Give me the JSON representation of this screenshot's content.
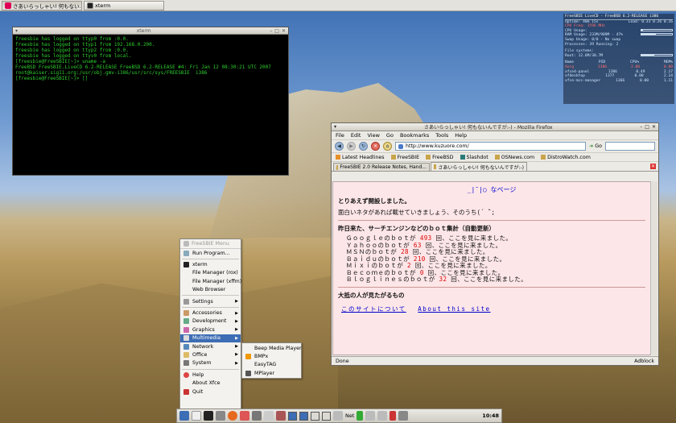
{
  "taskbar_top": [
    {
      "label": "さあいらっしゃい! 何もない...",
      "active": true
    },
    {
      "label": "xterm",
      "active": false
    }
  ],
  "conky": {
    "header": "FreeSBIE LiveCD - FreeBSD 6.2-RELEASE i386",
    "uptime": "Uptime: 40m 15s",
    "load": "Load: 0.33 0.26 0.26",
    "cpu_freq": "CPU Freq: 1596 MHz",
    "cpu_usage": "CPU Usage:",
    "ram_usage": "RAM Usage: 233M/989M - 47%",
    "swap_usage": "Swap Usage: 0/0 - No swap",
    "processes": "Processes: 39  Running: 2",
    "fs_label": "File systems:",
    "fs_root": "Root: 12.6M/30.7M",
    "cols": [
      "Name",
      "PID",
      "CPU%",
      "MEM%"
    ],
    "procs": [
      [
        "Xorg",
        "1386",
        "2.00",
        "0.00"
      ],
      [
        "xfce4-panel",
        "1386",
        "0.49",
        "2.17"
      ],
      [
        "xfdesktop",
        "1377",
        "0.00",
        "2.14"
      ],
      [
        "xfce-mcs-manager",
        "1366",
        "0.00",
        "1.11"
      ]
    ]
  },
  "xterm": {
    "title": "xterm",
    "lines": [
      "freesbie has logged on ttyp0 from :0.0.",
      "freesbie has logged on ttyp1 from 192.168.0.200.",
      "freesbie has logged on ttyp2 from :0.0.",
      "freesbie has logged on ttyv0 from local.",
      "[freesbie@FreeSBIE[~]> uname -a",
      "FreeBSD FreeSBIE.LiveCD 6.2-RELEASE FreeBSD 6.2-RELEASE #4: Fri Jan 12 08:30:21 UTC 2007     root@kaiser.sig11.org:/usr/obj.gmv-i386/usr/src/sys/FREESBIE  i386",
      "[freesbie@FreeSBIE[~]> []"
    ]
  },
  "firefox": {
    "title": "さあいらっしゃい! 何もないんですが:-) - Mozilla Firefox",
    "menu": [
      "File",
      "Edit",
      "View",
      "Go",
      "Bookmarks",
      "Tools",
      "Help"
    ],
    "url": "http://www.kuzuore.com/",
    "go_label": "Go",
    "search_placeholder": "",
    "bookmarks": [
      "Latest Headlines",
      "FreeSBIE",
      "FreeBSD",
      "Slashdot",
      "OSNews.com",
      "DistroWatch.com"
    ],
    "tabs": [
      "FreeSBIE 2.0 Release Notes, Hand...",
      "さあいらっしゃい! 何もないんですが:-)"
    ],
    "page": {
      "title": "_|¯|○ なページ",
      "intro": "とりあえず開設しました。",
      "line2": "面白いネタがあれば載せていきましょう、そのうち(´ ̄`;",
      "section1": "昨日来た、サーチエンジンなどのｂｏｔ集計（自動更新）",
      "bots": [
        {
          "name": "Ｇｏｏｇｌｅ",
          "count": "493"
        },
        {
          "name": "Ｙａｈｏｏ",
          "count": "63"
        },
        {
          "name": "ＭＳＮ",
          "count": "28"
        },
        {
          "name": "Ｂａｉｄｕ",
          "count": "210"
        },
        {
          "name": "Ｍｉｘｉ",
          "count": "2"
        },
        {
          "name": "Ｂｅｃｏｍｅ",
          "count": "0"
        },
        {
          "name": "Ｂｌｏｇｌｉｎｅｓ",
          "count": "32"
        }
      ],
      "bot_mid": "のｂｏｔが",
      "bot_suffix": "回、ここを見に来ました。",
      "section2": "大抵の人が見たがるもの",
      "link1": "このサイトについて",
      "link2": "About this site"
    },
    "status": "Done",
    "adblock": "Adblock"
  },
  "menu": {
    "title": "FreeSBIE Menu",
    "items": [
      "Run Program...",
      "xterm",
      "File Manager (rox)",
      "File Manager (xffm)",
      "Web Browser",
      "Settings",
      "Accessories",
      "Development",
      "Graphics",
      "Multimedia",
      "Network",
      "Office",
      "System",
      "Help",
      "About Xfce",
      "Quit"
    ]
  },
  "submenu": [
    "Beep Media Player",
    "BMPx",
    "EasyTAG",
    "MPlayer"
  ],
  "bottom_panel": {
    "net_label": "Net",
    "clock": "10:48"
  }
}
